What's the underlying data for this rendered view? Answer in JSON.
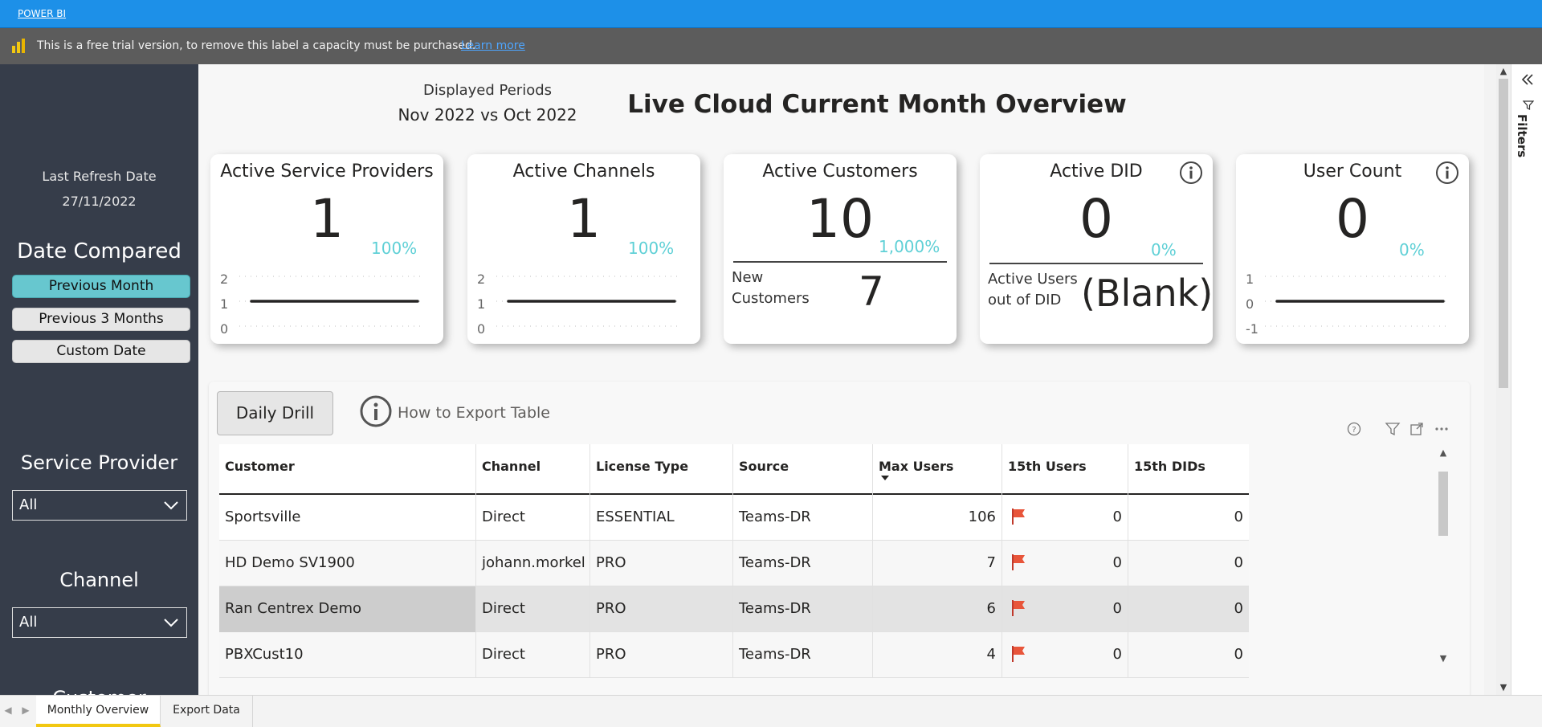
{
  "app": {
    "brand": "POWER BI"
  },
  "trial_banner": {
    "message": "This is a free trial version, to remove this label a capacity must be purchased.",
    "link": "Learn more"
  },
  "sidebar": {
    "last_refresh_label": "Last Refresh Date",
    "last_refresh_value": "27/11/2022",
    "date_compared_title": "Date Compared",
    "date_options": [
      {
        "label": "Previous Month",
        "active": true
      },
      {
        "label": "Previous 3 Months",
        "active": false
      },
      {
        "label": "Custom Date",
        "active": false
      }
    ],
    "service_provider": {
      "title": "Service Provider",
      "value": "All"
    },
    "channel": {
      "title": "Channel",
      "value": "All"
    },
    "customer_title_cut": "Customer"
  },
  "header": {
    "displayed_periods_label": "Displayed Periods",
    "displayed_periods_value": "Nov 2022 vs Oct 2022",
    "title": "Live Cloud Current Month Overview"
  },
  "cards": [
    {
      "title": "Active Service Providers",
      "value": "1",
      "pct": "100%",
      "axis": [
        "2",
        "1",
        "0"
      ],
      "spark_level": 1,
      "axis_range": [
        0,
        2
      ]
    },
    {
      "title": "Active Channels",
      "value": "1",
      "pct": "100%",
      "axis": [
        "2",
        "1",
        "0"
      ],
      "spark_level": 1,
      "axis_range": [
        0,
        2
      ]
    },
    {
      "title": "Active Customers",
      "value": "10",
      "pct": "1,000%",
      "sub_label_1": "New",
      "sub_label_2": "Customers",
      "sub_value": "7"
    },
    {
      "title": "Active DID",
      "value": "0",
      "pct": "0%",
      "sub_label_1": "Active Users",
      "sub_label_2": "out of DID",
      "sub_value": "(Blank)",
      "info": true
    },
    {
      "title": "User Count",
      "value": "0",
      "pct": "0%",
      "axis": [
        "1",
        "0",
        "-1"
      ],
      "spark_level": 0,
      "axis_range": [
        -1,
        1
      ],
      "info": true
    }
  ],
  "table_panel": {
    "drill_button": "Daily Drill",
    "export_label": "How to Export Table",
    "columns": [
      "Customer",
      "Channel",
      "License Type",
      "Source",
      "Max Users",
      "15th Users",
      "15th DIDs"
    ],
    "rows": [
      {
        "customer": "Sportsville",
        "channel": "Direct",
        "license": "ESSENTIAL",
        "source": "Teams-DR",
        "max_users": "106",
        "users15": "0",
        "dids15": "0"
      },
      {
        "customer": "HD Demo SV1900",
        "channel": "johann.morkel",
        "license": "PRO",
        "source": "Teams-DR",
        "max_users": "7",
        "users15": "0",
        "dids15": "0"
      },
      {
        "customer": "Ran Centrex Demo",
        "channel": "Direct",
        "license": "PRO",
        "source": "Teams-DR",
        "max_users": "6",
        "users15": "0",
        "dids15": "0",
        "selected": true
      },
      {
        "customer": "PBXCust10",
        "channel": "Direct",
        "license": "PRO",
        "source": "Teams-DR",
        "max_users": "4",
        "users15": "0",
        "dids15": "0"
      }
    ]
  },
  "filters_pane": {
    "label": "Filters"
  },
  "colors": {
    "accent": "#67c7cf",
    "sidebar": "#363d4a",
    "titlebar": "#1d90e8",
    "pct": "#5fd0d6",
    "flag": "#e8553a",
    "tab_active": "#f2c811"
  },
  "tabs": [
    {
      "label": "Monthly Overview",
      "active": true
    },
    {
      "label": "Export Data",
      "active": false
    }
  ]
}
